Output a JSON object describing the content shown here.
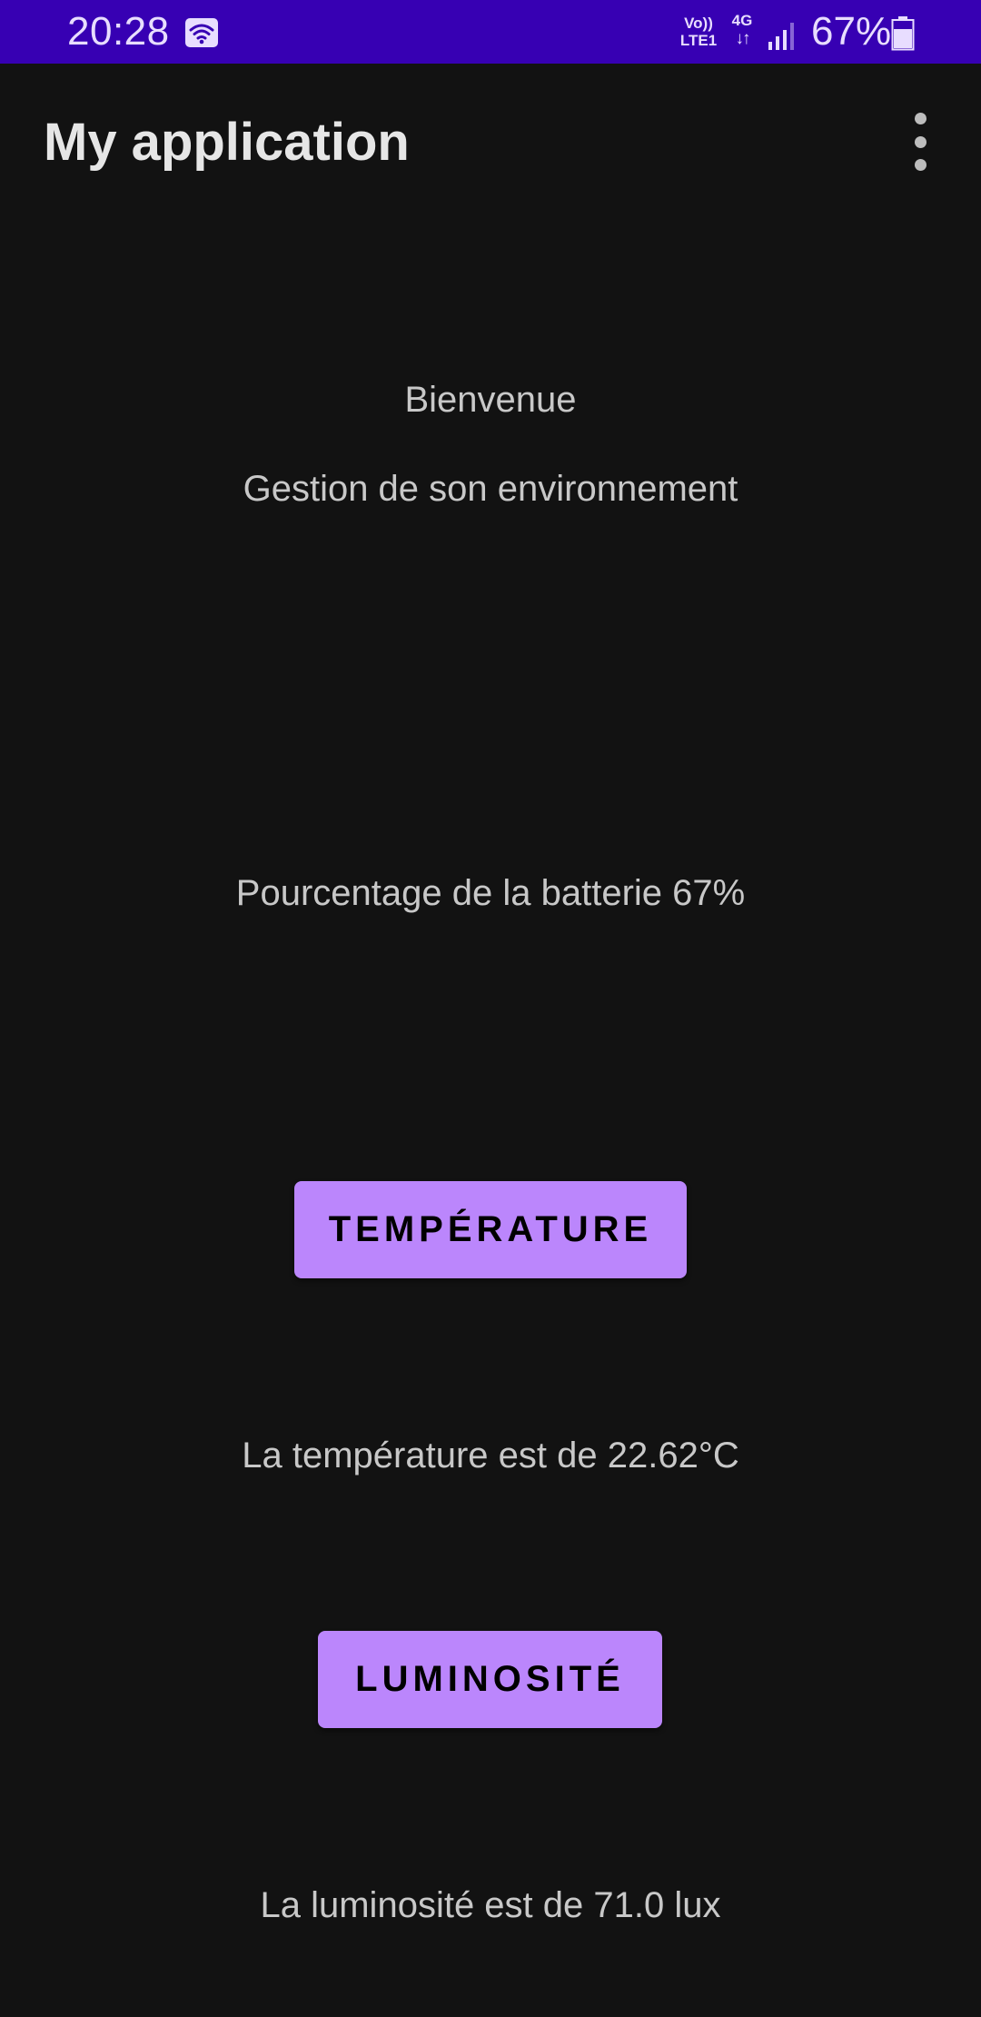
{
  "status_bar": {
    "time": "20:28",
    "volte_line1": "Vo))",
    "volte_line2": "LTE1",
    "network_type": "4G",
    "network_arrows": "↓↑",
    "battery_percent": "67%",
    "battery_level": 0.67,
    "background_color": "#3700b3",
    "icons": [
      "wifi-icon",
      "signal-icon",
      "battery-icon"
    ]
  },
  "app_bar": {
    "title": "My application",
    "menu_icon": "more-vertical-icon"
  },
  "main": {
    "welcome": "Bienvenue",
    "subtitle": "Gestion de son environnement",
    "battery_info": "Pourcentage de la batterie 67%",
    "temperature_button": "TEMPÉRATURE",
    "temperature_result": "La température est de 22.62°C",
    "luminosity_button": "LUMINOSITÉ",
    "luminosity_result": "La luminosité est de 71.0 lux"
  },
  "colors": {
    "accent": "#bb86fc",
    "background": "#121212",
    "status_bar": "#3700b3",
    "text": "#c8c8c8"
  }
}
